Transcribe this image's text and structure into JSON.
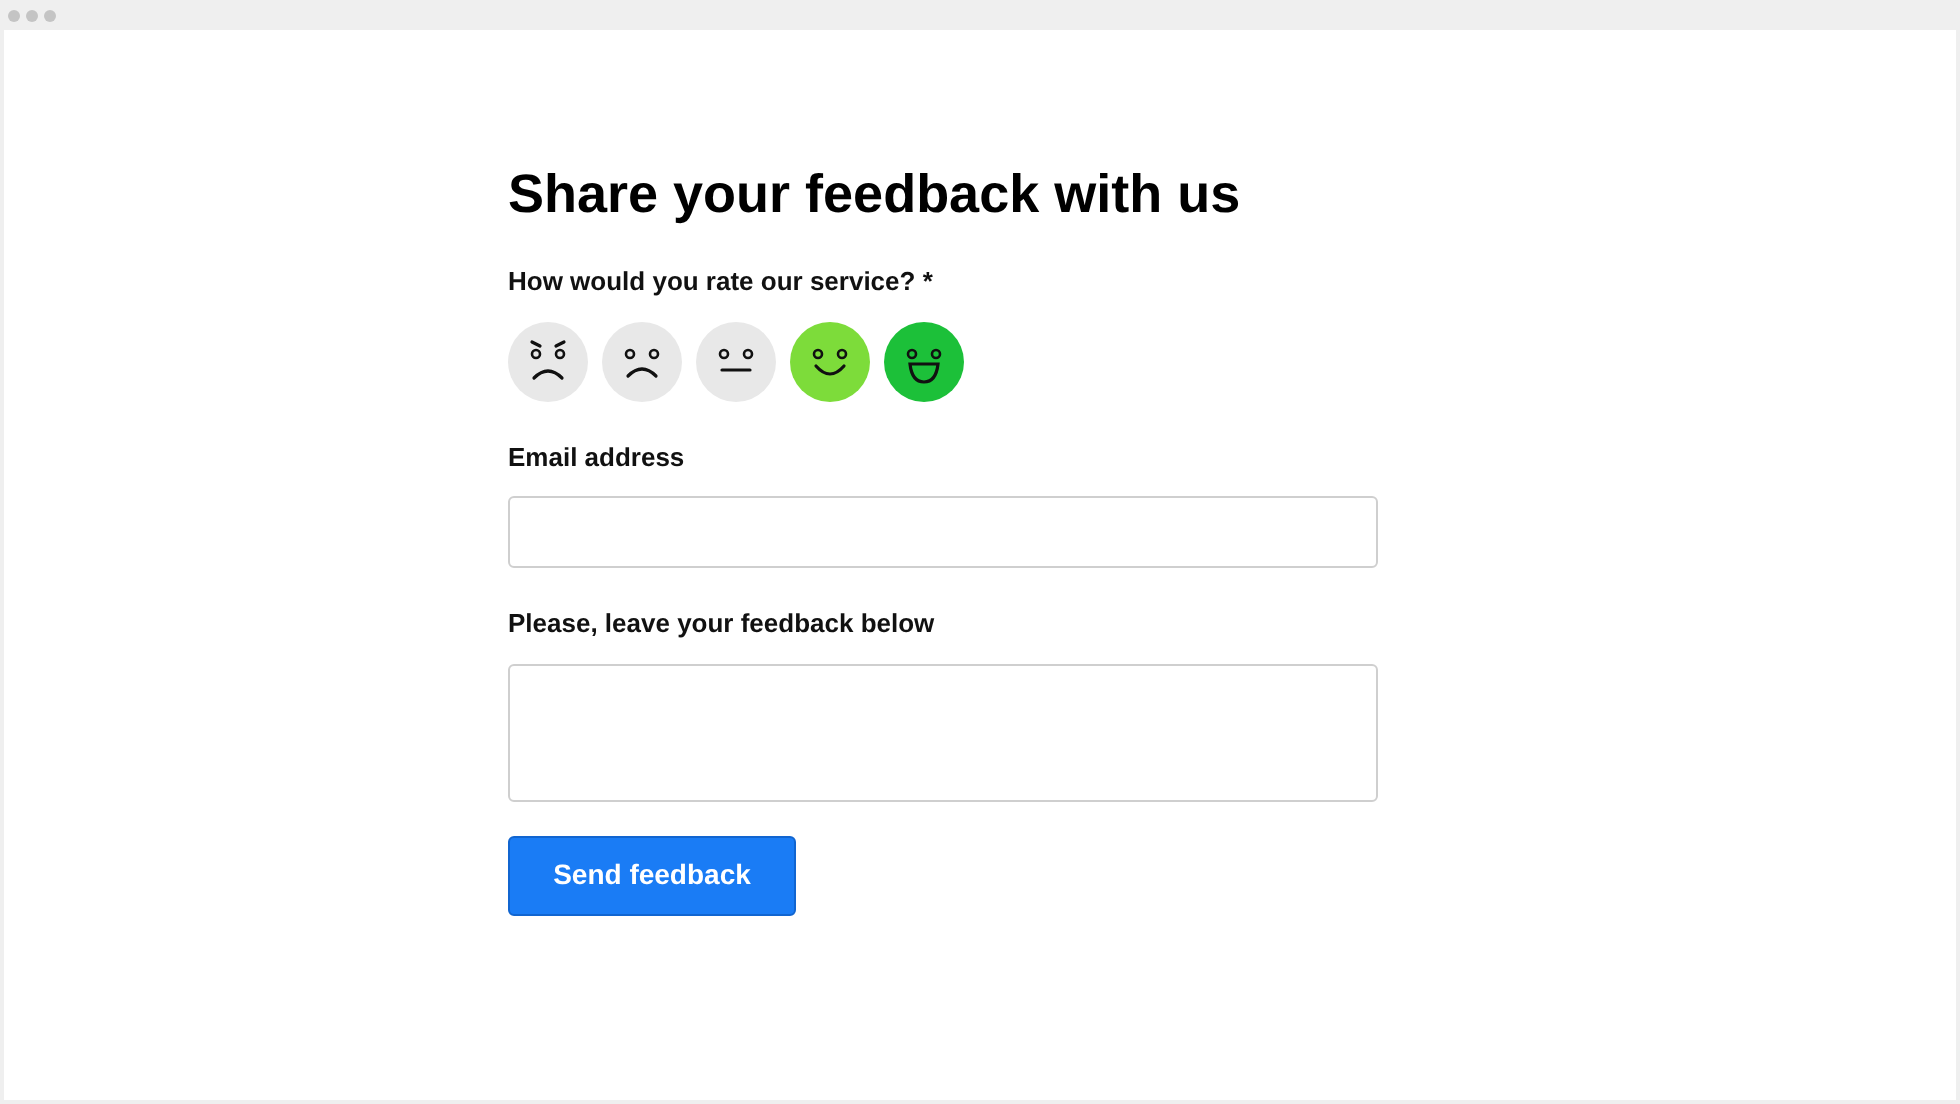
{
  "title": "Share your feedback with us",
  "rating": {
    "label": "How would you rate our service? *",
    "faces": [
      {
        "kind": "angry",
        "color": "#e8e8e8"
      },
      {
        "kind": "sad",
        "color": "#e8e8e8"
      },
      {
        "kind": "neutral",
        "color": "#e8e8e8"
      },
      {
        "kind": "happy",
        "color": "#7ddc3a"
      },
      {
        "kind": "delighted",
        "color": "#1cc039"
      }
    ]
  },
  "email": {
    "label": "Email address"
  },
  "feedback": {
    "label": "Please, leave your feedback below"
  },
  "submit": "Send feedback"
}
